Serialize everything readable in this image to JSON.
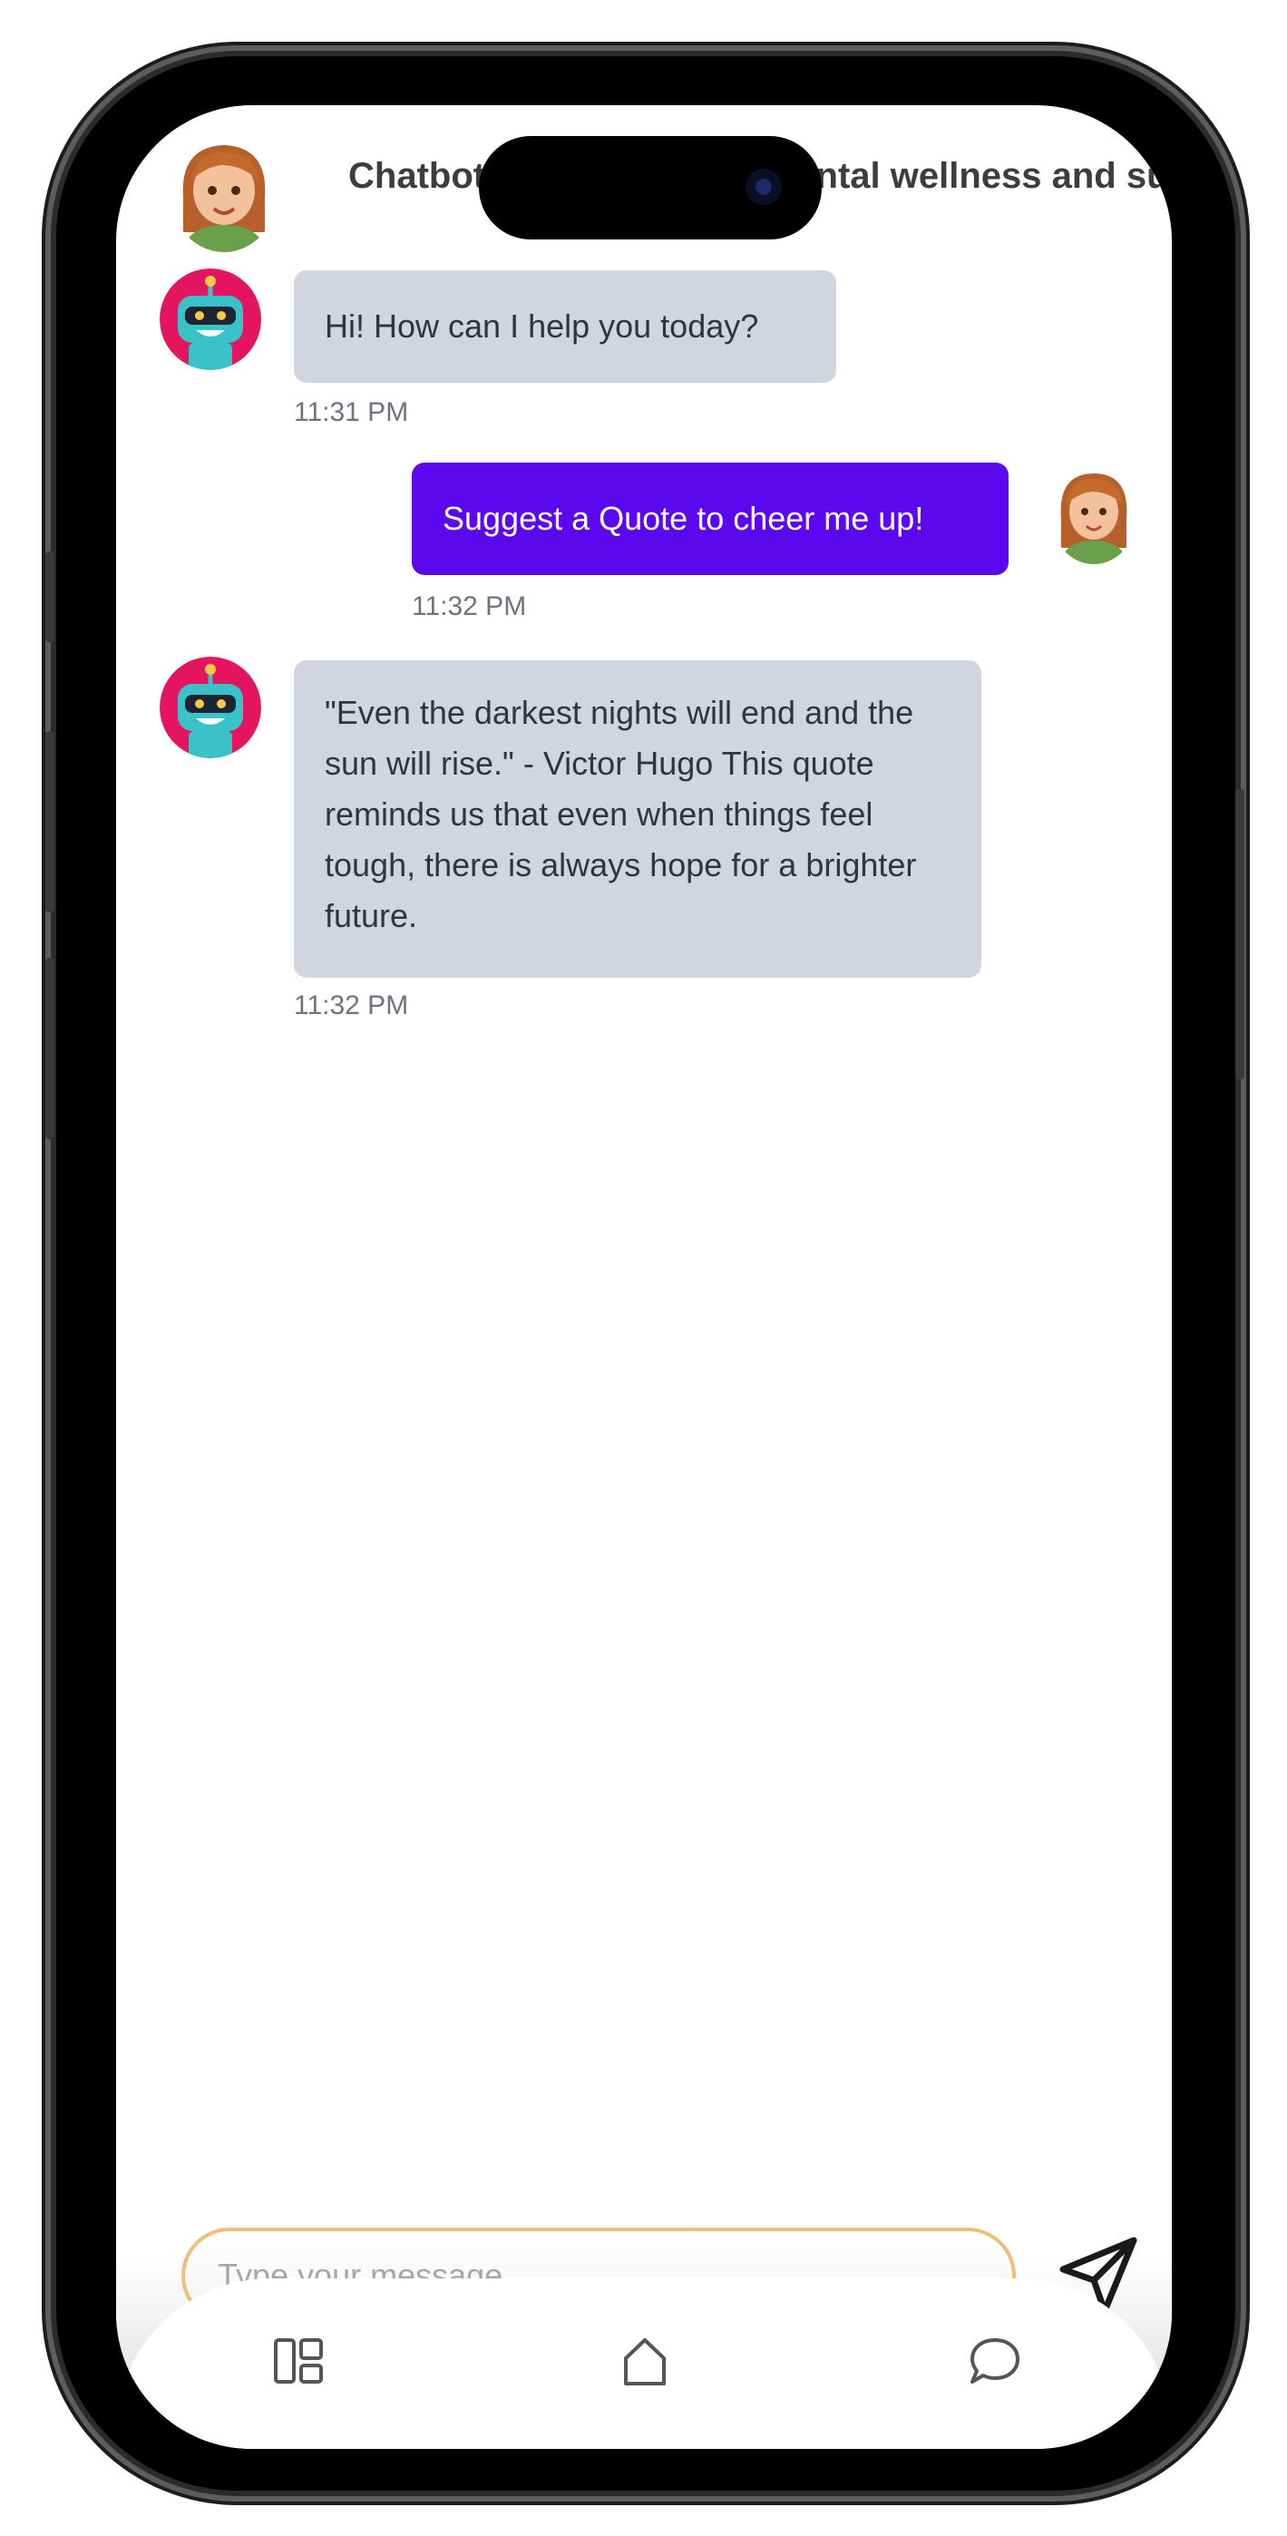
{
  "header": {
    "title": "Chatbot Companion for mental wellness and support"
  },
  "messages": [
    {
      "sender": "bot",
      "text": "Hi! How can I help you today?",
      "time": "11:31 PM"
    },
    {
      "sender": "user",
      "text": "Suggest a Quote to cheer me up!",
      "time": "11:32 PM"
    },
    {
      "sender": "bot",
      "text": "\"Even the darkest nights will end and the sun will rise.\" - Victor Hugo This quote reminds us that even when things feel tough, there is always hope for a brighter future.",
      "time": "11:32 PM"
    }
  ],
  "composer": {
    "placeholder": "Type your message...",
    "value": "",
    "send_icon": "send-icon"
  },
  "nav": {
    "items": [
      {
        "icon": "dashboard-icon"
      },
      {
        "icon": "home-icon"
      },
      {
        "icon": "chat-icon"
      }
    ]
  },
  "colors": {
    "user_bubble": "#5b08ee",
    "bot_bubble": "#d2d5df",
    "input_border": "#efbf79",
    "bot_avatar": "#e4155e"
  }
}
